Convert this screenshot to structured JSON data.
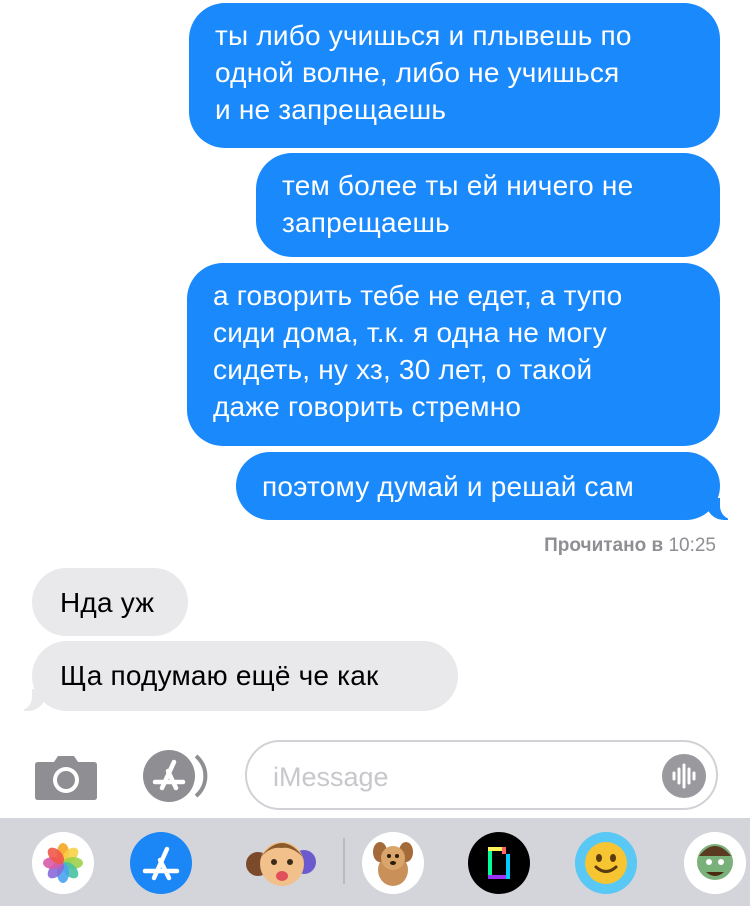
{
  "messages": [
    {
      "type": "sent",
      "lines": [
        "ты либо учишься и плывешь по",
        "одной волне, либо не учишься",
        "и не запрещаешь"
      ]
    },
    {
      "type": "sent",
      "lines": [
        "тем более ты ей ничего не",
        "запрещаешь"
      ]
    },
    {
      "type": "sent",
      "lines": [
        "а говорить тебе не едет, а тупо",
        "сиди дома, т.к. я одна не могу",
        "сидеть, ну хз, 30 лет, о такой",
        "даже говорить стремно"
      ]
    },
    {
      "type": "sent",
      "lines": [
        "поэтому думай и решай сам"
      ]
    },
    {
      "type": "received",
      "lines": [
        "Нда уж"
      ]
    },
    {
      "type": "received",
      "lines": [
        "Ща подумаю ещё че как"
      ]
    }
  ],
  "read_receipt": {
    "label": "Прочитано в",
    "time": "10:25"
  },
  "input": {
    "placeholder": "iMessage"
  },
  "icons": {
    "camera": "camera-icon",
    "app_store": "app-store-icon",
    "audio": "audio-waveform-icon"
  },
  "app_drawer": [
    "photos-app-icon",
    "app-store-app-icon",
    "memoji-app-icon",
    "dog-sticker-app-icon",
    "gif-app-icon",
    "animoji-app-icon",
    "character-sticker-app-icon"
  ],
  "colors": {
    "sent_bubble": "#1a89fb",
    "received_bubble": "#e9e9eb",
    "drawer_bg": "#d3d5db"
  }
}
